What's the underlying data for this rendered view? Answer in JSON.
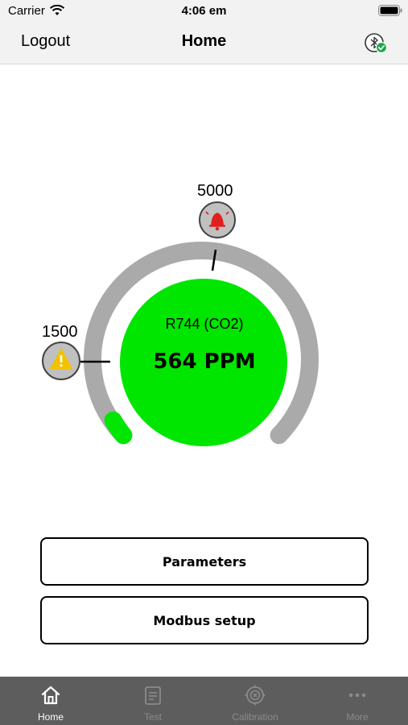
{
  "status_bar": {
    "carrier": "Carrier",
    "time": "4:06 em"
  },
  "nav": {
    "left_button": "Logout",
    "title": "Home",
    "status_icon": "bluetooth-connected-icon"
  },
  "gauge": {
    "gas_name": "R744 (CO2)",
    "reading": "564 PPM",
    "current_value": 564,
    "alarm_threshold": 5000,
    "alarm_icon": "bell-alarm-icon",
    "warning_threshold": 1500,
    "warning_icon": "warning-triangle-icon",
    "colors": {
      "track": "#aaaaaa",
      "level": "#00e600",
      "center": "#00e600",
      "alarm": "#e02020",
      "warning": "#f2c200"
    }
  },
  "buttons": {
    "parameters": "Parameters",
    "modbus_setup": "Modbus setup"
  },
  "tab_bar": {
    "tabs": [
      {
        "label": "Home",
        "icon": "home-icon",
        "active": true
      },
      {
        "label": "Test",
        "icon": "clipboard-icon",
        "active": false
      },
      {
        "label": "Calibration",
        "icon": "target-icon",
        "active": false
      },
      {
        "label": "More",
        "icon": "more-dots-icon",
        "active": false
      }
    ]
  }
}
